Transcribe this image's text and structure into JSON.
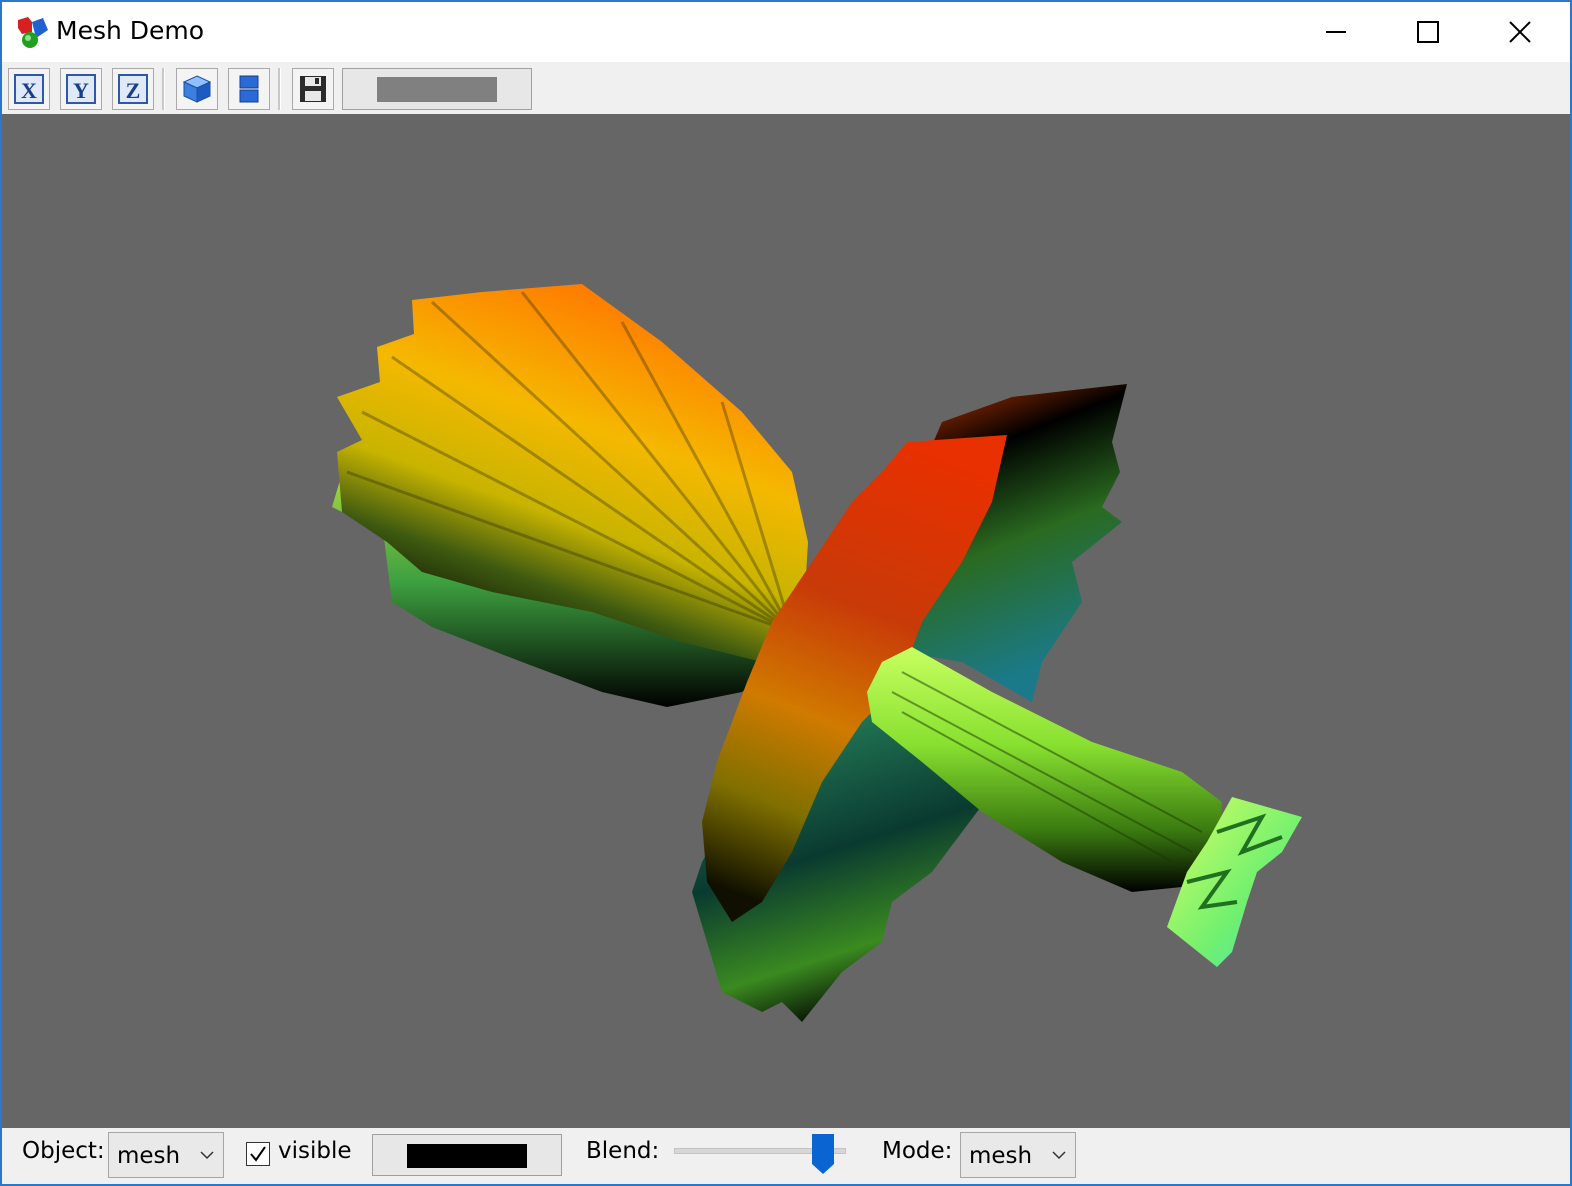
{
  "window": {
    "title": "Mesh Demo",
    "icons": {
      "app": "app-cubes-icon",
      "minimize": "minimize-icon",
      "maximize": "maximize-icon",
      "close": "close-icon"
    }
  },
  "toolbar": {
    "buttons": [
      {
        "icon": "x-axis-view-icon",
        "glyph": "X"
      },
      {
        "icon": "y-axis-view-icon",
        "glyph": "Y"
      },
      {
        "icon": "z-axis-view-icon",
        "glyph": "Z"
      },
      {
        "icon": "3d-cube-view-icon"
      },
      {
        "icon": "layout-split-icon"
      },
      {
        "icon": "save-icon"
      }
    ],
    "background_color": "#808080"
  },
  "viewport": {
    "background": "#666666",
    "content": "3D mesh rendered with rainbow colormap"
  },
  "statusbar": {
    "object_label": "Object:",
    "object_value": "mesh",
    "visible_label": "visible",
    "visible_checked": true,
    "mesh_color": "#000000",
    "blend_label": "Blend:",
    "blend_level_percent": 92,
    "mode_label": "Mode:",
    "mode_value": "mesh"
  },
  "colors": {
    "accent": "#0a64d2",
    "window_border": "#2b78c9"
  }
}
